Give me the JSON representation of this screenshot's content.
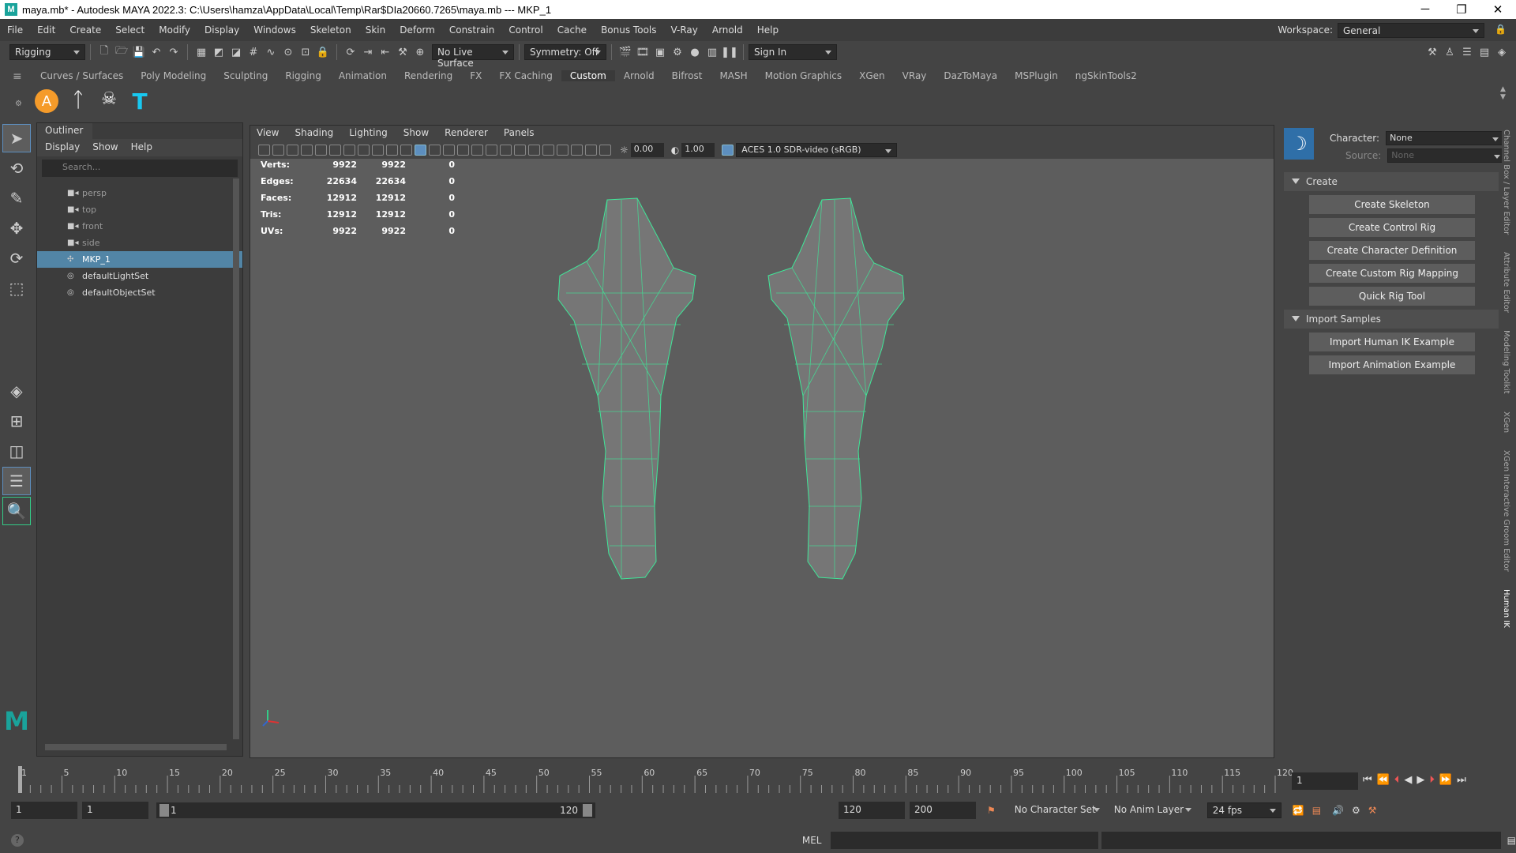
{
  "titlebar": {
    "title": "maya.mb* - Autodesk MAYA 2022.3: C:\\Users\\hamza\\AppData\\Local\\Temp\\Rar$DIa20660.7265\\maya.mb  ---  MKP_1"
  },
  "menubar": {
    "items": [
      "File",
      "Edit",
      "Create",
      "Select",
      "Modify",
      "Display",
      "Windows",
      "Skeleton",
      "Skin",
      "Deform",
      "Constrain",
      "Control",
      "Cache",
      "Bonus Tools",
      "V-Ray",
      "Arnold",
      "Help"
    ],
    "workspace_label": "Workspace:",
    "workspace_value": "General"
  },
  "statusline": {
    "menuset": "Rigging",
    "live_surface": "No Live Surface",
    "symmetry": "Symmetry: Off",
    "signin": "Sign In"
  },
  "shelftabs": [
    "Curves / Surfaces",
    "Poly Modeling",
    "Sculpting",
    "Rigging",
    "Animation",
    "Rendering",
    "FX",
    "FX Caching",
    "Custom",
    "Arnold",
    "Bifrost",
    "MASH",
    "Motion Graphics",
    "XGen",
    "VRay",
    "DazToMaya",
    "MSPlugin",
    "ngSkinTools2"
  ],
  "shelftabs_active": "Custom",
  "outliner": {
    "title": "Outliner",
    "menu": [
      "Display",
      "Show",
      "Help"
    ],
    "search_placeholder": "Search...",
    "items": [
      "persp",
      "top",
      "front",
      "side",
      "MKP_1",
      "defaultLightSet",
      "defaultObjectSet"
    ],
    "selected": "MKP_1"
  },
  "viewport": {
    "menu": [
      "View",
      "Shading",
      "Lighting",
      "Show",
      "Renderer",
      "Panels"
    ],
    "exposure": "0.00",
    "gamma": "1.00",
    "colorspace": "ACES 1.0 SDR-video (sRGB)",
    "mesh_color": "#3fe899"
  },
  "hud": [
    {
      "label": "Verts:",
      "a": "9922",
      "b": "9922",
      "c": "0"
    },
    {
      "label": "Edges:",
      "a": "22634",
      "b": "22634",
      "c": "0"
    },
    {
      "label": "Faces:",
      "a": "12912",
      "b": "12912",
      "c": "0"
    },
    {
      "label": "Tris:",
      "a": "12912",
      "b": "12912",
      "c": "0"
    },
    {
      "label": "UVs:",
      "a": "9922",
      "b": "9922",
      "c": "0"
    }
  ],
  "character_controls": {
    "character_label": "Character:",
    "character_value": "None",
    "source_label": "Source:",
    "source_value": "None",
    "create_header": "Create",
    "create_buttons": [
      "Create Skeleton",
      "Create Control Rig",
      "Create Character Definition",
      "Create Custom Rig Mapping",
      "Quick Rig Tool"
    ],
    "import_header": "Import Samples",
    "import_buttons": [
      "Import Human IK Example",
      "Import Animation Example"
    ]
  },
  "right_tabs": [
    "Channel Box / Layer Editor",
    "Attribute Editor",
    "Modeling Toolkit",
    "XGen",
    "XGen Interactive Groom Editor",
    "Human IK"
  ],
  "timeline": {
    "ticks": [
      "1",
      "5",
      "10",
      "15",
      "20",
      "25",
      "30",
      "35",
      "40",
      "45",
      "50",
      "55",
      "60",
      "65",
      "70",
      "75",
      "80",
      "85",
      "90",
      "95",
      "100",
      "105",
      "110",
      "115",
      "120"
    ],
    "current_frame": "1"
  },
  "range": {
    "start": "1",
    "anim_start": "1",
    "slider_start": "1",
    "slider_end": "120",
    "end": "120",
    "anim_end": "200",
    "character_set": "No Character Set",
    "anim_layer": "No Anim Layer",
    "fps": "24 fps"
  },
  "cmdline": {
    "lang": "MEL"
  }
}
